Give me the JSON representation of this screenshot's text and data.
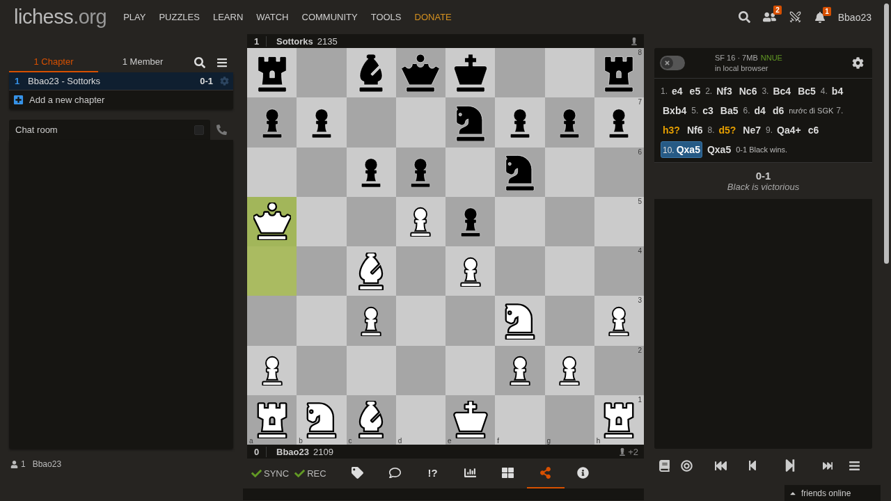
{
  "header": {
    "logo": {
      "main": "lichess",
      "suffix": ".org"
    },
    "nav": [
      {
        "label": "PLAY",
        "kind": "link"
      },
      {
        "label": "PUZZLES",
        "kind": "link"
      },
      {
        "label": "LEARN",
        "kind": "link"
      },
      {
        "label": "WATCH",
        "kind": "link"
      },
      {
        "label": "COMMUNITY",
        "kind": "link"
      },
      {
        "label": "TOOLS",
        "kind": "link"
      },
      {
        "label": "DONATE",
        "kind": "donate"
      }
    ],
    "friends_badge": "2",
    "notifications_badge": "1",
    "username": "Bbao23"
  },
  "study": {
    "tabs": [
      {
        "label": "1 Chapter",
        "selected": true
      },
      {
        "label": "1 Member",
        "selected": false
      }
    ],
    "chapters": [
      {
        "number": "1",
        "name": "Bbao23 - Sottorks",
        "result": "0-1",
        "selected": true
      }
    ],
    "add_chapter": "Add a new chapter"
  },
  "chat": {
    "title": "Chat room",
    "checked": false
  },
  "members": {
    "count": "1",
    "name": "Bbao23"
  },
  "board": {
    "top_player": {
      "score": "1",
      "name": "Sottorks",
      "rating": "2135"
    },
    "bottom_player": {
      "score": "0",
      "name": "Bbao23",
      "rating": "2109",
      "material": "+2"
    },
    "ranks": [
      {
        "squares": [
          {
            "kind": "rook",
            "color": "#000000",
            "highlighted": false
          },
          {
            "kind": "empty",
            "highlighted": false
          },
          {
            "kind": "bishop",
            "color": "#000000",
            "highlighted": false
          },
          {
            "kind": "queen",
            "color": "#000000",
            "highlighted": false
          },
          {
            "kind": "king",
            "color": "#000000",
            "highlighted": false
          },
          {
            "kind": "empty",
            "highlighted": false
          },
          {
            "kind": "empty",
            "highlighted": false
          },
          {
            "kind": "rook",
            "color": "#000000",
            "highlighted": false
          }
        ]
      },
      {
        "squares": [
          {
            "kind": "pawn",
            "color": "#000000",
            "highlighted": false
          },
          {
            "kind": "pawn",
            "color": "#000000",
            "highlighted": false
          },
          {
            "kind": "empty",
            "highlighted": false
          },
          {
            "kind": "empty",
            "highlighted": false
          },
          {
            "kind": "knight",
            "color": "#000000",
            "highlighted": false
          },
          {
            "kind": "pawn",
            "color": "#000000",
            "highlighted": false
          },
          {
            "kind": "pawn",
            "color": "#000000",
            "highlighted": false
          },
          {
            "kind": "pawn",
            "color": "#000000",
            "highlighted": false
          }
        ]
      },
      {
        "squares": [
          {
            "kind": "empty",
            "highlighted": false
          },
          {
            "kind": "empty",
            "highlighted": false
          },
          {
            "kind": "pawn",
            "color": "#000000",
            "highlighted": false
          },
          {
            "kind": "pawn",
            "color": "#000000",
            "highlighted": false
          },
          {
            "kind": "empty",
            "highlighted": false
          },
          {
            "kind": "knight",
            "color": "#000000",
            "highlighted": false
          },
          {
            "kind": "empty",
            "highlighted": false
          },
          {
            "kind": "empty",
            "highlighted": false
          }
        ]
      },
      {
        "squares": [
          {
            "kind": "queen",
            "color": "#ffffff",
            "highlighted": true
          },
          {
            "kind": "empty",
            "highlighted": false
          },
          {
            "kind": "empty",
            "highlighted": false
          },
          {
            "kind": "pawn",
            "color": "#ffffff",
            "highlighted": false
          },
          {
            "kind": "pawn",
            "color": "#000000",
            "highlighted": false
          },
          {
            "kind": "empty",
            "highlighted": false
          },
          {
            "kind": "empty",
            "highlighted": false
          },
          {
            "kind": "empty",
            "highlighted": false
          }
        ]
      },
      {
        "squares": [
          {
            "kind": "empty",
            "highlighted": true
          },
          {
            "kind": "empty",
            "highlighted": false
          },
          {
            "kind": "bishop",
            "color": "#ffffff",
            "highlighted": false
          },
          {
            "kind": "empty",
            "highlighted": false
          },
          {
            "kind": "pawn",
            "color": "#ffffff",
            "highlighted": false
          },
          {
            "kind": "empty",
            "highlighted": false
          },
          {
            "kind": "empty",
            "highlighted": false
          },
          {
            "kind": "empty",
            "highlighted": false
          }
        ]
      },
      {
        "squares": [
          {
            "kind": "empty",
            "highlighted": false
          },
          {
            "kind": "empty",
            "highlighted": false
          },
          {
            "kind": "pawn",
            "color": "#ffffff",
            "highlighted": false
          },
          {
            "kind": "empty",
            "highlighted": false
          },
          {
            "kind": "empty",
            "highlighted": false
          },
          {
            "kind": "knight",
            "color": "#ffffff",
            "highlighted": false
          },
          {
            "kind": "empty",
            "highlighted": false
          },
          {
            "kind": "pawn",
            "color": "#ffffff",
            "highlighted": false
          }
        ]
      },
      {
        "squares": [
          {
            "kind": "pawn",
            "color": "#ffffff",
            "highlighted": false
          },
          {
            "kind": "empty",
            "highlighted": false
          },
          {
            "kind": "empty",
            "highlighted": false
          },
          {
            "kind": "empty",
            "highlighted": false
          },
          {
            "kind": "empty",
            "highlighted": false
          },
          {
            "kind": "pawn",
            "color": "#ffffff",
            "highlighted": false
          },
          {
            "kind": "pawn",
            "color": "#ffffff",
            "highlighted": false
          },
          {
            "kind": "empty",
            "highlighted": false
          }
        ]
      },
      {
        "squares": [
          {
            "kind": "rook",
            "color": "#ffffff",
            "highlighted": false
          },
          {
            "kind": "knight",
            "color": "#ffffff",
            "highlighted": false
          },
          {
            "kind": "bishop",
            "color": "#ffffff",
            "highlighted": false
          },
          {
            "kind": "empty",
            "highlighted": false
          },
          {
            "kind": "king",
            "color": "#ffffff",
            "highlighted": false
          },
          {
            "kind": "empty",
            "highlighted": false
          },
          {
            "kind": "empty",
            "highlighted": false
          },
          {
            "kind": "rook",
            "color": "#ffffff",
            "highlighted": false
          }
        ]
      }
    ],
    "rank_labels": [
      "8",
      "7",
      "6",
      "5",
      "4",
      "3",
      "2",
      "1"
    ],
    "file_labels": [
      "a",
      "b",
      "c",
      "d",
      "e",
      "f",
      "g",
      "h"
    ]
  },
  "toolbar": {
    "sync": "SYNC",
    "rec": "REC",
    "tools": [
      {
        "kind": "tags",
        "selected": false
      },
      {
        "kind": "comments",
        "selected": false
      },
      {
        "kind": "glyphs",
        "label": "!?",
        "selected": false
      },
      {
        "kind": "chart",
        "selected": false
      },
      {
        "kind": "multiboard",
        "selected": false
      },
      {
        "kind": "share",
        "selected": true
      },
      {
        "kind": "info",
        "selected": false
      }
    ]
  },
  "engine": {
    "on": false,
    "name": "SF 16 · 7MB",
    "badge": "NNUE",
    "location": "in local browser"
  },
  "moves": [
    {
      "kind": "index",
      "text": "1."
    },
    {
      "kind": "move",
      "text": "e4",
      "selected": false
    },
    {
      "kind": "move",
      "text": "e5",
      "selected": false
    },
    {
      "kind": "index",
      "text": "2."
    },
    {
      "kind": "move",
      "text": "Nf3",
      "selected": false
    },
    {
      "kind": "move",
      "text": "Nc6",
      "selected": false
    },
    {
      "kind": "index",
      "text": "3."
    },
    {
      "kind": "move",
      "text": "Bc4",
      "selected": false
    },
    {
      "kind": "move",
      "text": "Bc5",
      "selected": false
    },
    {
      "kind": "index",
      "text": "4."
    },
    {
      "kind": "move",
      "text": "b4",
      "selected": false
    },
    {
      "kind": "move",
      "text": "Bxb4",
      "selected": false
    },
    {
      "kind": "index",
      "text": "5."
    },
    {
      "kind": "move",
      "text": "c3",
      "selected": false
    },
    {
      "kind": "move",
      "text": "Ba5",
      "selected": false
    },
    {
      "kind": "index",
      "text": "6."
    },
    {
      "kind": "move",
      "text": "d4",
      "selected": false
    },
    {
      "kind": "move",
      "text": "d6",
      "selected": false
    },
    {
      "kind": "comment",
      "text": "nước đi SGK"
    },
    {
      "kind": "index",
      "text": "7."
    },
    {
      "kind": "dubious",
      "text": "h3?",
      "selected": false
    },
    {
      "kind": "move",
      "text": "Nf6",
      "selected": false
    },
    {
      "kind": "index",
      "text": "8."
    },
    {
      "kind": "dubious",
      "text": "d5?",
      "selected": false
    },
    {
      "kind": "move",
      "text": "Ne7",
      "selected": false
    },
    {
      "kind": "index",
      "text": "9."
    },
    {
      "kind": "move",
      "text": "Qa4+",
      "selected": false
    },
    {
      "kind": "move",
      "text": "c6",
      "selected": false
    },
    {
      "kind": "move",
      "index": "10.",
      "text": "Qxa5",
      "selected": true
    },
    {
      "kind": "move",
      "text": "Qxa5",
      "selected": false
    },
    {
      "kind": "comment",
      "text": "0-1 Black wins."
    }
  ],
  "result": {
    "score": "0-1",
    "text": "Black is victorious"
  },
  "controls": [
    {
      "kind": "book"
    },
    {
      "kind": "practice"
    },
    {
      "kind": "first"
    },
    {
      "kind": "prev"
    },
    {
      "kind": "next"
    },
    {
      "kind": "last"
    },
    {
      "kind": "menu"
    }
  ],
  "friends": {
    "label": "friends online"
  }
}
